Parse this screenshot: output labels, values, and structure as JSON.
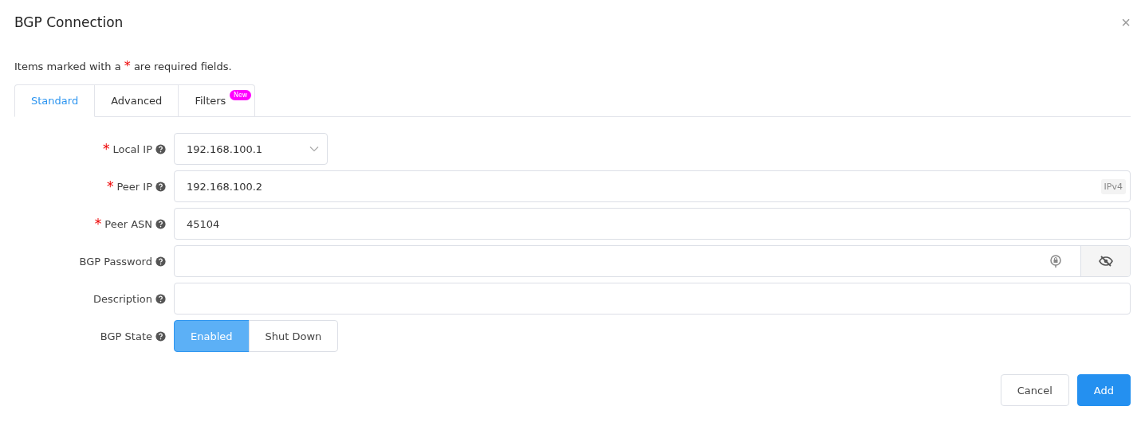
{
  "dialog": {
    "title": "BGP Connection",
    "close": "×"
  },
  "note": {
    "before": "Items marked with a",
    "mark": "*",
    "after": "are required fields."
  },
  "tabs": [
    {
      "label": "Standard",
      "selected": true
    },
    {
      "label": "Advanced",
      "selected": false
    },
    {
      "label": "Filters",
      "selected": false,
      "badge": "New"
    }
  ],
  "fields": [
    {
      "kind": "select",
      "label": "Local IP",
      "required_mark": "*",
      "value": "192.168.100.1"
    },
    {
      "kind": "text",
      "label": "Peer IP",
      "required_mark": "*",
      "value": "192.168.100.2",
      "addon": "IPv4"
    },
    {
      "kind": "text",
      "label": "Peer ASN",
      "required_mark": "*",
      "value": "45104"
    },
    {
      "kind": "password",
      "label": "BGP Password"
    },
    {
      "kind": "text",
      "label": "Description"
    },
    {
      "kind": "toggle",
      "label": "BGP State",
      "options": [
        {
          "label": "Enabled",
          "selected": true
        },
        {
          "label": "Shut Down",
          "selected": false
        }
      ]
    }
  ],
  "buttons": [
    {
      "label": "Cancel",
      "kind": "secondary"
    },
    {
      "label": "Add",
      "kind": "primary"
    }
  ]
}
